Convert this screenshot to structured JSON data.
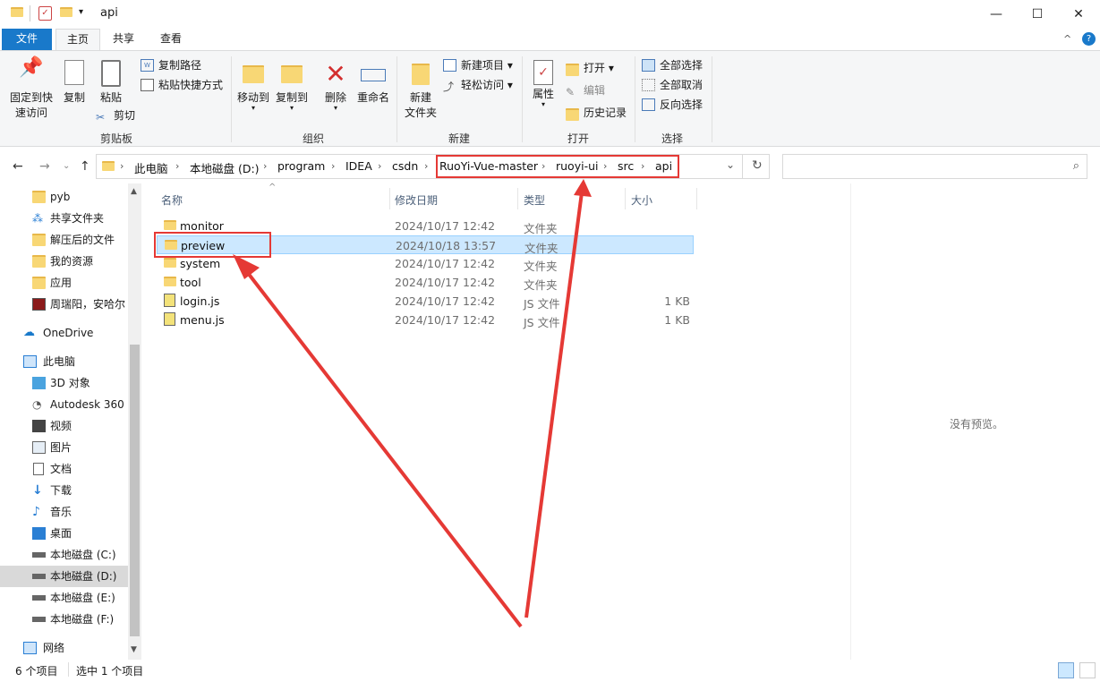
{
  "window": {
    "title": "api",
    "min": "—",
    "max": "☐",
    "close": "✕"
  },
  "tabs": {
    "file": "文件",
    "home": "主页",
    "share": "共享",
    "view": "查看"
  },
  "ribbon": {
    "clipboard": {
      "pin": "固定到快\n速访问",
      "copy": "复制",
      "paste": "粘贴",
      "copy_path": "复制路径",
      "paste_shortcut": "粘贴快捷方式",
      "cut": "剪切",
      "label": "剪贴板"
    },
    "organize": {
      "move_to": "移动到",
      "copy_to": "复制到",
      "delete": "删除",
      "rename": "重命名",
      "label": "组织"
    },
    "new": {
      "new_folder": "新建\n文件夹",
      "new_item": "新建项目",
      "easy_access": "轻松访问",
      "label": "新建"
    },
    "open": {
      "properties": "属性",
      "open": "打开",
      "edit": "编辑",
      "history": "历史记录",
      "label": "打开"
    },
    "select": {
      "select_all": "全部选择",
      "select_none": "全部取消",
      "invert": "反向选择",
      "label": "选择"
    }
  },
  "address": {
    "crumbs": [
      "此电脑",
      "本地磁盘 (D:)",
      "program",
      "IDEA",
      "csdn",
      "RuoYi-Vue-master",
      "ruoyi-ui",
      "src",
      "api"
    ]
  },
  "nav": {
    "items": [
      "pyb",
      "共享文件夹",
      "解压后的文件",
      "我的资源",
      "应用",
      "周瑞阳，安哈尔",
      "OneDrive",
      "此电脑",
      "3D 对象",
      "Autodesk 360",
      "视频",
      "图片",
      "文档",
      "下载",
      "音乐",
      "桌面",
      "本地磁盘 (C:)",
      "本地磁盘 (D:)",
      "本地磁盘 (E:)",
      "本地磁盘 (F:)",
      "网络"
    ]
  },
  "columns": {
    "name": "名称",
    "date": "修改日期",
    "type": "类型",
    "size": "大小"
  },
  "files": [
    {
      "name": "monitor",
      "date": "2024/10/17 12:42",
      "type": "文件夹",
      "size": ""
    },
    {
      "name": "preview",
      "date": "2024/10/18 13:57",
      "type": "文件夹",
      "size": ""
    },
    {
      "name": "system",
      "date": "2024/10/17 12:42",
      "type": "文件夹",
      "size": ""
    },
    {
      "name": "tool",
      "date": "2024/10/17 12:42",
      "type": "文件夹",
      "size": ""
    },
    {
      "name": "login.js",
      "date": "2024/10/17 12:42",
      "type": "JS 文件",
      "size": "1 KB"
    },
    {
      "name": "menu.js",
      "date": "2024/10/17 12:42",
      "type": "JS 文件",
      "size": "1 KB"
    }
  ],
  "preview": {
    "empty": "没有预览。"
  },
  "status": {
    "count": "6 个项目",
    "selected": "选中 1 个项目"
  },
  "colors": {
    "accent": "#1979ca",
    "annotation": "#e53935",
    "selection": "#cce8ff"
  }
}
